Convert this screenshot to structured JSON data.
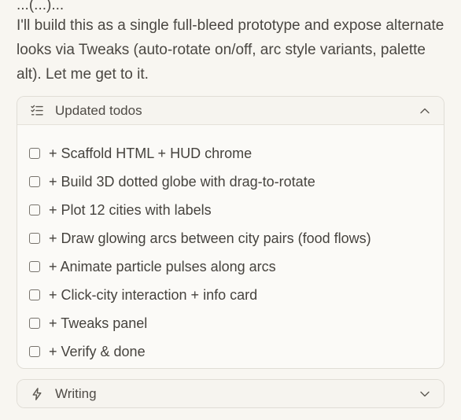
{
  "top_clipped_text": "...(...)...",
  "intro_text": "I'll build this as a single full-bleed prototype and expose alternate looks via Tweaks (auto-rotate on/off, arc style variants, palette alt). Let me get to it.",
  "todos_panel": {
    "title": "Updated todos",
    "icon": "checklist-icon",
    "expanded": true,
    "items": [
      {
        "label": "+ Scaffold HTML + HUD chrome",
        "checked": false
      },
      {
        "label": "+ Build 3D dotted globe with drag-to-rotate",
        "checked": false
      },
      {
        "label": "+ Plot 12 cities with labels",
        "checked": false
      },
      {
        "label": "+ Draw glowing arcs between city pairs (food flows)",
        "checked": false
      },
      {
        "label": "+ Animate particle pulses along arcs",
        "checked": false
      },
      {
        "label": "+ Click-city interaction + info card",
        "checked": false
      },
      {
        "label": "+ Tweaks panel",
        "checked": false
      },
      {
        "label": "+ Verify & done",
        "checked": false
      }
    ]
  },
  "writing_panel": {
    "title": "Writing",
    "icon": "lightning-icon",
    "expanded": false
  }
}
